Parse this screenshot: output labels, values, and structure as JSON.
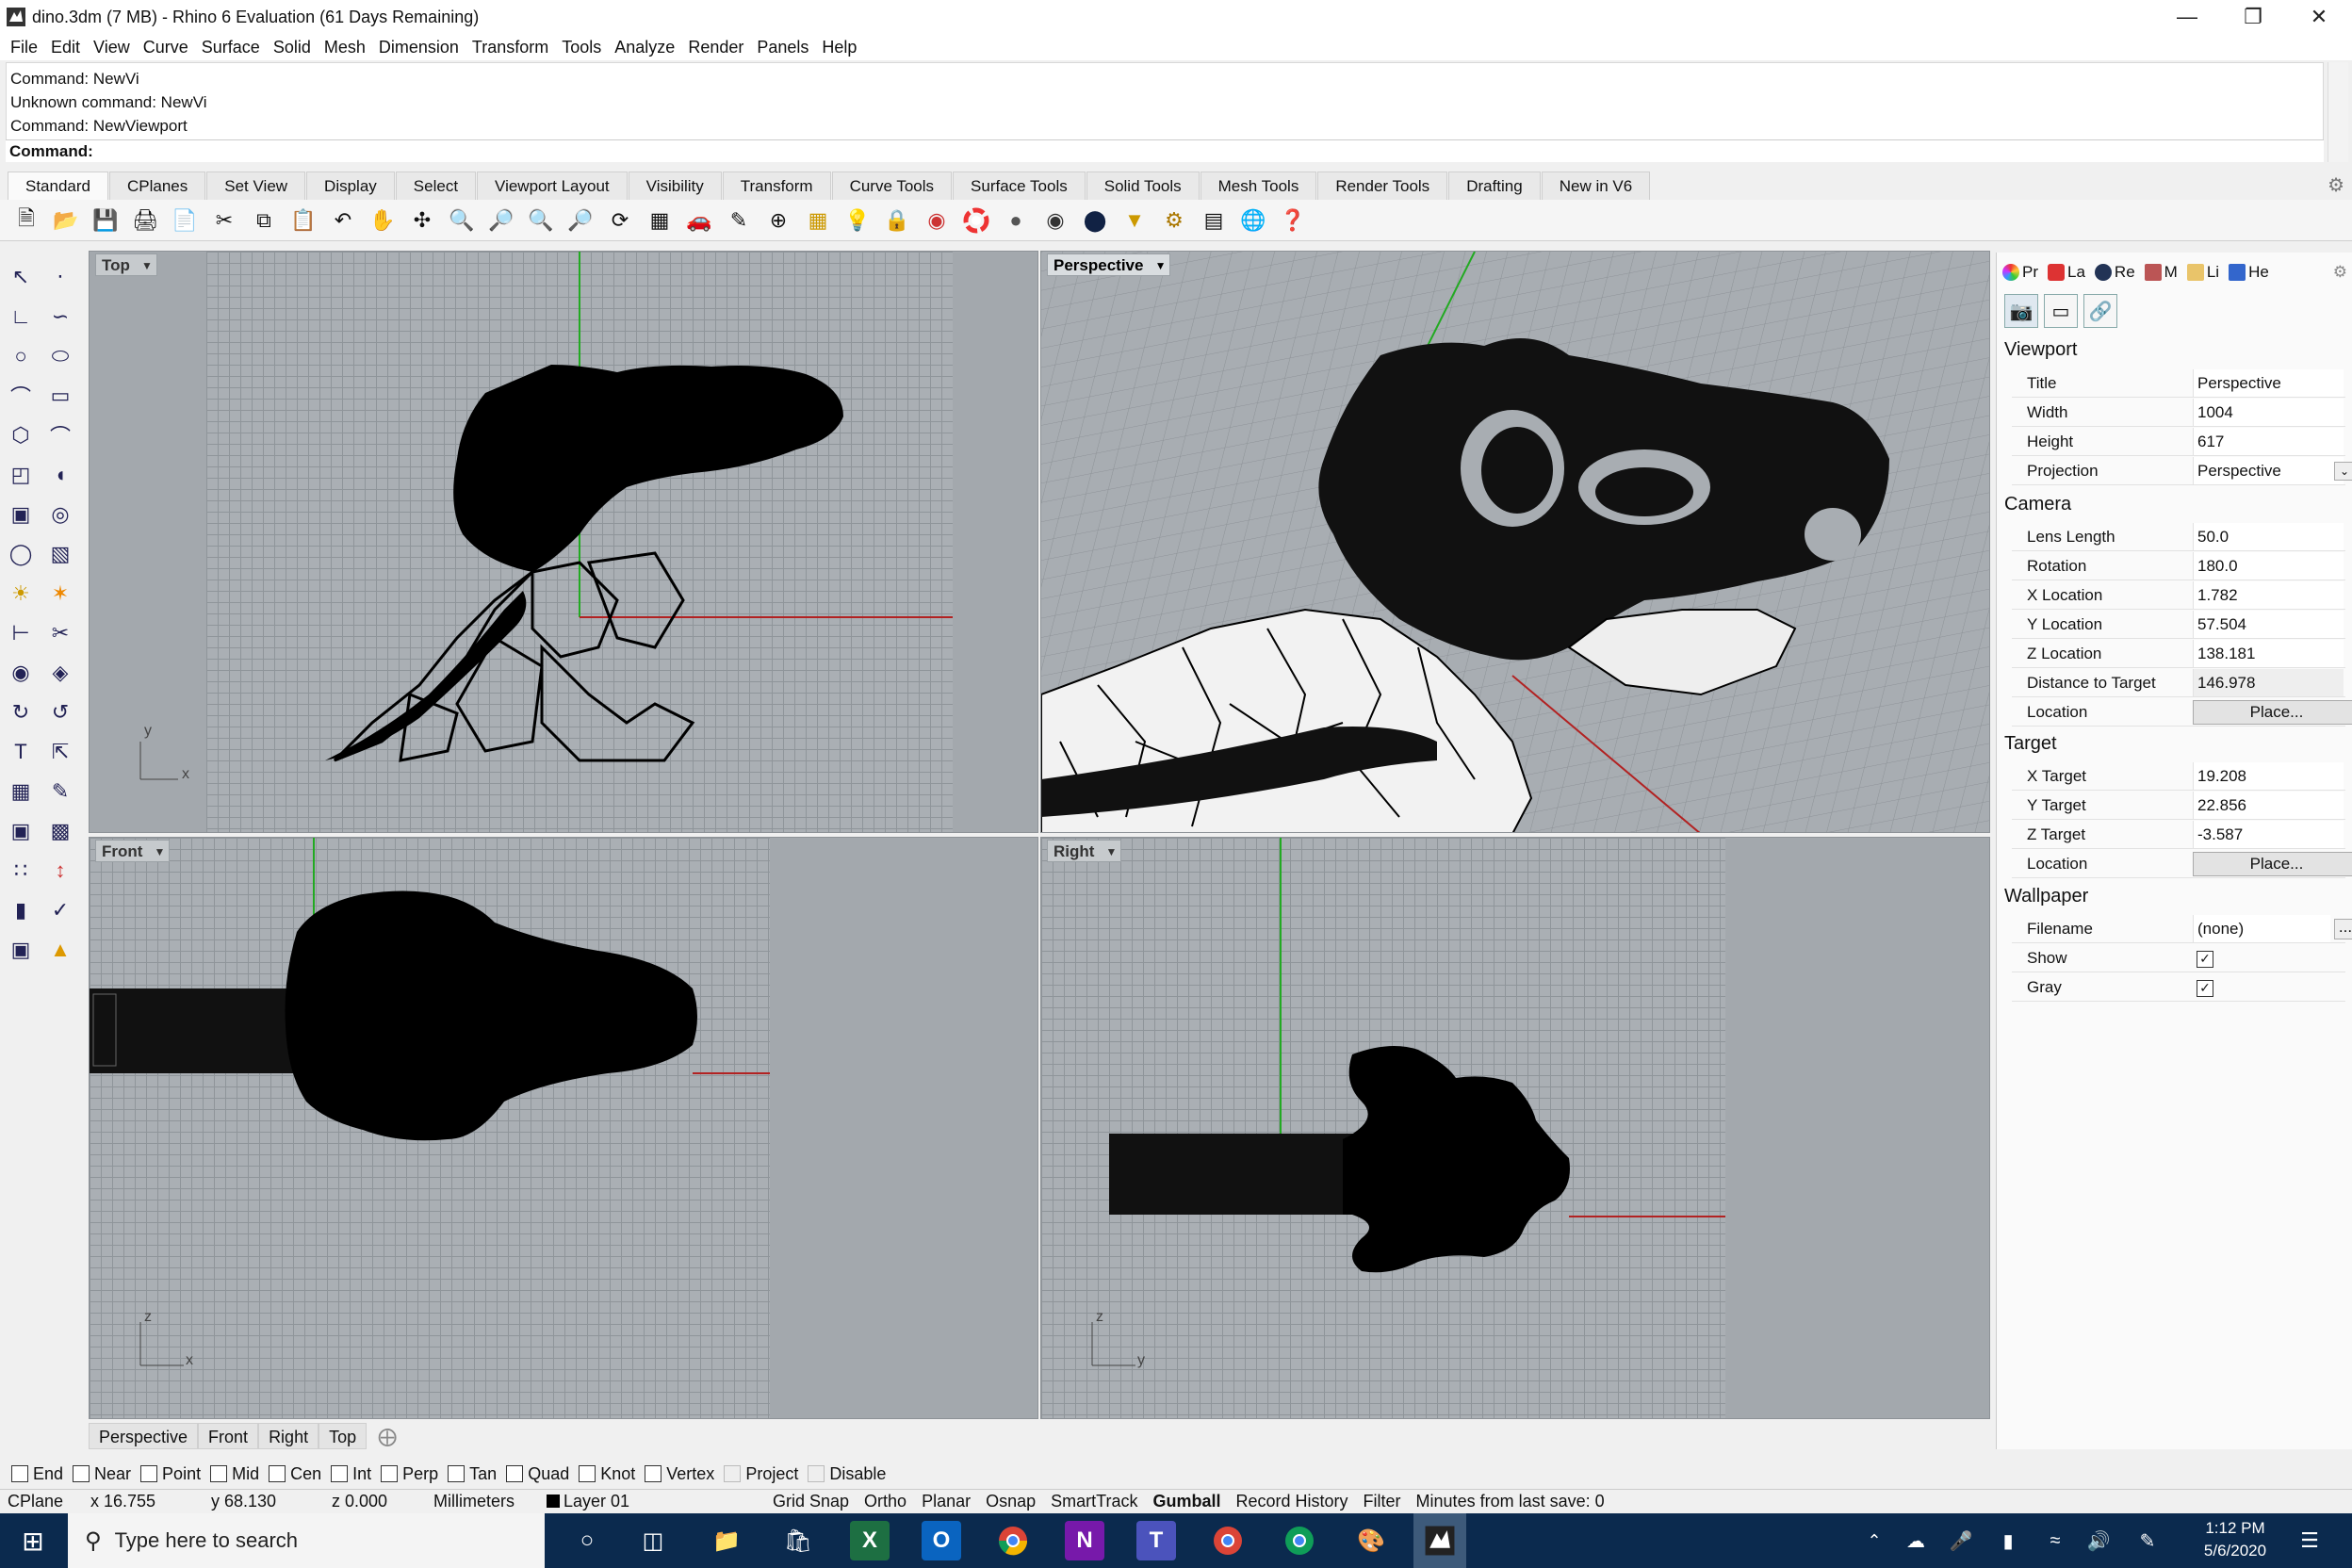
{
  "window": {
    "title": "dino.3dm (7 MB) - Rhino 6 Evaluation (61 Days Remaining)",
    "controls": [
      "minimize",
      "restore",
      "close"
    ]
  },
  "menu": [
    "File",
    "Edit",
    "View",
    "Curve",
    "Surface",
    "Solid",
    "Mesh",
    "Dimension",
    "Transform",
    "Tools",
    "Analyze",
    "Render",
    "Panels",
    "Help"
  ],
  "command": {
    "history": [
      "Command: NewVi",
      "Unknown command: NewVi",
      "Command: NewViewport"
    ],
    "prompt": "Command:"
  },
  "toolbar_tabs": [
    "Standard",
    "CPlanes",
    "Set View",
    "Display",
    "Select",
    "Viewport Layout",
    "Visibility",
    "Transform",
    "Curve Tools",
    "Surface Tools",
    "Solid Tools",
    "Mesh Tools",
    "Render Tools",
    "Drafting",
    "New in V6"
  ],
  "active_tab": "Standard",
  "toolbar_icons": [
    "new-icon",
    "open-icon",
    "save-icon",
    "print-icon",
    "import-icon",
    "cut-icon",
    "copy-icon",
    "paste-icon",
    "undo-icon",
    "pan-icon",
    "rotate-view-icon",
    "zoom-icon",
    "zoom-window-icon",
    "zoom-extents-icon",
    "zoom-selected-icon",
    "rotate-icon",
    "grid-layout-icon",
    "car-icon",
    "named-views-icon",
    "cplane-icon",
    "snap-icon",
    "light-icon",
    "lock-icon",
    "layers-icon",
    "color-wheel-icon",
    "shade-icon",
    "render-preview-icon",
    "render-icon",
    "filter-icon",
    "options-icon",
    "select-points-icon",
    "help-globe-icon",
    "help-icon"
  ],
  "viewports": {
    "top": {
      "label": "Top",
      "axis_y": "y",
      "axis_x": "x"
    },
    "perspective": {
      "label": "Perspective"
    },
    "front": {
      "label": "Front",
      "axis_y": "z",
      "axis_x": "x"
    },
    "right": {
      "label": "Right",
      "axis_y": "z",
      "axis_x": "y"
    }
  },
  "viewport_tabs": [
    "Perspective",
    "Front",
    "Right",
    "Top"
  ],
  "osnaps": [
    {
      "label": "End",
      "checked": false
    },
    {
      "label": "Near",
      "checked": false
    },
    {
      "label": "Point",
      "checked": false
    },
    {
      "label": "Mid",
      "checked": false
    },
    {
      "label": "Cen",
      "checked": false
    },
    {
      "label": "Int",
      "checked": false
    },
    {
      "label": "Perp",
      "checked": false
    },
    {
      "label": "Tan",
      "checked": false
    },
    {
      "label": "Quad",
      "checked": false
    },
    {
      "label": "Knot",
      "checked": false
    },
    {
      "label": "Vertex",
      "checked": false
    },
    {
      "label": "Project",
      "checked": false,
      "disabled": true
    },
    {
      "label": "Disable",
      "checked": false,
      "disabled": true
    }
  ],
  "status": {
    "cplane": "CPlane",
    "x": "x 16.755",
    "y": "y 68.130",
    "z": "z 0.000",
    "units": "Millimeters",
    "layer": "Layer 01",
    "grid_snap": "Grid Snap",
    "ortho": "Ortho",
    "planar": "Planar",
    "osnap": "Osnap",
    "smarttrack": "SmartTrack",
    "gumball": "Gumball",
    "record_history": "Record History",
    "filter": "Filter",
    "save_info": "Minutes from last save: 0"
  },
  "panel": {
    "tabs": [
      "Pr",
      "La",
      "Re",
      "M",
      "Li",
      "He"
    ],
    "sections": {
      "viewport": "Viewport",
      "camera": "Camera",
      "target": "Target",
      "wallpaper": "Wallpaper"
    },
    "viewport_props": [
      {
        "key": "Title",
        "value": "Perspective"
      },
      {
        "key": "Width",
        "value": "1004"
      },
      {
        "key": "Height",
        "value": "617"
      },
      {
        "key": "Projection",
        "value": "Perspective"
      }
    ],
    "camera_props": [
      {
        "key": "Lens Length",
        "value": "50.0"
      },
      {
        "key": "Rotation",
        "value": "180.0"
      },
      {
        "key": "X Location",
        "value": "1.782"
      },
      {
        "key": "Y Location",
        "value": "57.504"
      },
      {
        "key": "Z Location",
        "value": "138.181"
      },
      {
        "key": "Distance to Target",
        "value": "146.978"
      },
      {
        "key": "Location",
        "value": "Place..."
      }
    ],
    "target_props": [
      {
        "key": "X Target",
        "value": "19.208"
      },
      {
        "key": "Y Target",
        "value": "22.856"
      },
      {
        "key": "Z Target",
        "value": "-3.587"
      },
      {
        "key": "Location",
        "value": "Place..."
      }
    ],
    "wallpaper_props": [
      {
        "key": "Filename",
        "value": "(none)"
      },
      {
        "key": "Show",
        "value": "checked"
      },
      {
        "key": "Gray",
        "value": "checked"
      }
    ],
    "more_button": "..."
  },
  "taskbar": {
    "search_placeholder": "Type here to search",
    "time": "1:12 PM",
    "date": "5/6/2020",
    "apps": [
      "cortana-icon",
      "task-view-icon",
      "file-explorer-icon",
      "store-icon",
      "excel-icon",
      "outlook-icon",
      "chrome-icon",
      "onenote-icon",
      "teams-icon",
      "chrome-alt-icon",
      "chrome-profile-icon",
      "paint-icon",
      "rhino-icon"
    ]
  },
  "colors": {
    "viewport_bg": "#a3a8ad",
    "grid_line": "#8f959a",
    "axis_x": "#b22222",
    "axis_y": "#22aa22",
    "taskbar": "#0b2a4e"
  }
}
